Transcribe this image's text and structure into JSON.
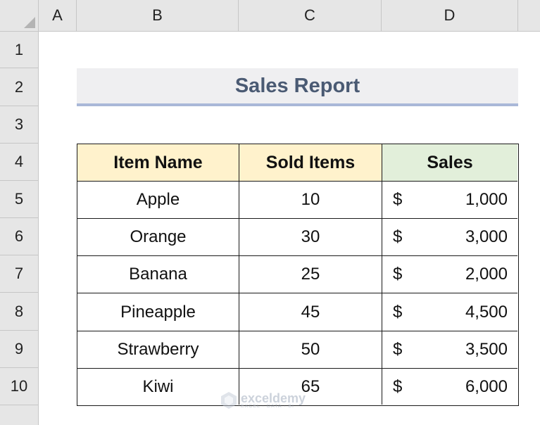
{
  "columns": [
    "A",
    "B",
    "C",
    "D"
  ],
  "rows": [
    "1",
    "2",
    "3",
    "4",
    "5",
    "6",
    "7",
    "8",
    "9",
    "10"
  ],
  "title": "Sales Report",
  "table": {
    "headers": [
      "Item Name",
      "Sold Items",
      "Sales"
    ],
    "rows": [
      {
        "item": "Apple",
        "sold": "10",
        "currency": "$",
        "sales": "1,000"
      },
      {
        "item": "Orange",
        "sold": "30",
        "currency": "$",
        "sales": "3,000"
      },
      {
        "item": "Banana",
        "sold": "25",
        "currency": "$",
        "sales": "2,000"
      },
      {
        "item": "Pineapple",
        "sold": "45",
        "currency": "$",
        "sales": "4,500"
      },
      {
        "item": "Strawberry",
        "sold": "50",
        "currency": "$",
        "sales": "3,500"
      },
      {
        "item": "Kiwi",
        "sold": "65",
        "currency": "$",
        "sales": "6,000"
      }
    ]
  },
  "colors": {
    "header_item_bg": "#fff2cc",
    "header_sold_bg": "#fff2cc",
    "header_sales_bg": "#e2efda",
    "title_bg": "#efeff1",
    "title_text": "#4a5a73",
    "title_underline": "#a9b8d8"
  },
  "watermark": {
    "name": "exceldemy",
    "tagline": "EXCEL · DATA · BI"
  }
}
